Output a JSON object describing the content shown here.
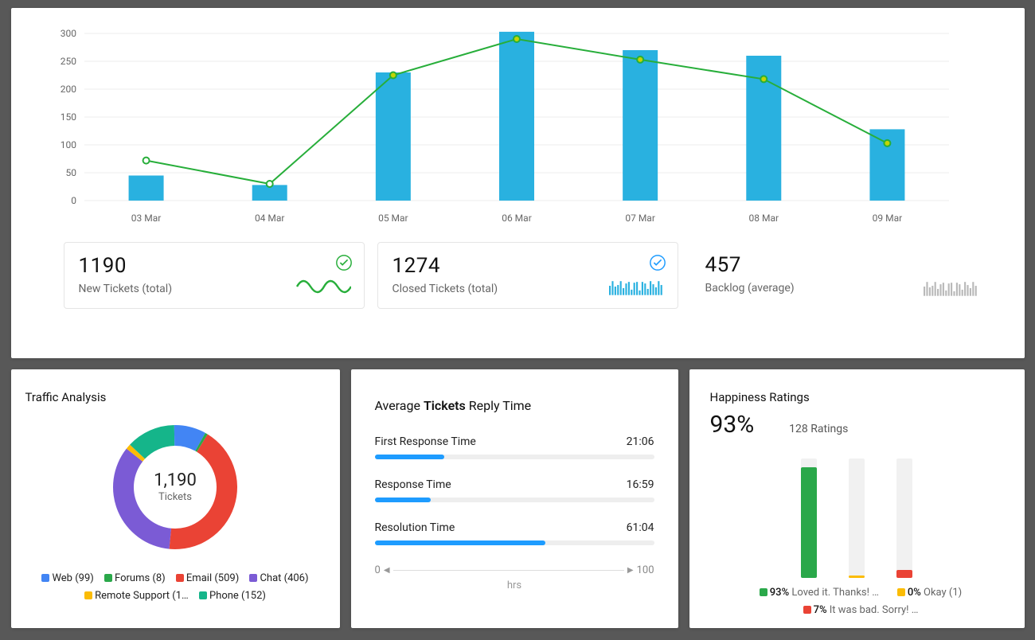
{
  "chart_data": {
    "type": "bar+line",
    "categories": [
      "03 Mar",
      "04 Mar",
      "05 Mar",
      "06 Mar",
      "07 Mar",
      "08 Mar",
      "09 Mar"
    ],
    "bars": [
      45,
      28,
      230,
      303,
      270,
      260,
      128
    ],
    "line": [
      72,
      30,
      225,
      290,
      253,
      218,
      103
    ],
    "ylim": [
      0,
      300
    ],
    "y_ticks": [
      0,
      50,
      100,
      150,
      200,
      250,
      300
    ]
  },
  "summary": {
    "new": {
      "value": "1190",
      "label": "New Tickets (total)"
    },
    "closed": {
      "value": "1274",
      "label": "Closed  Tickets (total)"
    },
    "backlog": {
      "value": "457",
      "label": "Backlog (average)"
    }
  },
  "colors": {
    "bar": "#29b1e0",
    "line": "#27ae3a",
    "gray_spark": "#b9b9b9"
  },
  "traffic": {
    "title": "Traffic Analysis",
    "total_value": "1,190",
    "total_label": "Tickets",
    "items": [
      {
        "label": "Web",
        "count": 99,
        "color": "#4285f4"
      },
      {
        "label": "Forums",
        "count": 8,
        "color": "#2aa84a"
      },
      {
        "label": "Email",
        "count": 509,
        "color": "#ea4335"
      },
      {
        "label": "Chat",
        "count": 406,
        "color": "#7b5bd5"
      },
      {
        "label": "Remote Support",
        "count": 16,
        "color": "#fbbc05",
        "display": "Remote Support (1…"
      },
      {
        "label": "Phone",
        "count": 152,
        "color": "#15b58a"
      }
    ]
  },
  "reply": {
    "title_pre": "Average",
    "title_bold": "Tickets",
    "title_post": "Reply Time",
    "metrics": [
      {
        "name": "First Response Time",
        "value": "21:06",
        "pct": 25
      },
      {
        "name": "Response Time",
        "value": "16:59",
        "pct": 20
      },
      {
        "name": "Resolution Time",
        "value": "61:04",
        "pct": 61
      }
    ],
    "axis_min": "0",
    "axis_max": "100",
    "axis_unit": "hrs"
  },
  "happiness": {
    "title": "Happiness Ratings",
    "big_pct": "93%",
    "ratings_label": "128 Ratings",
    "bars": [
      {
        "pct": 93,
        "color": "#2aa84a"
      },
      {
        "pct": 0,
        "color": "#fbbc05"
      },
      {
        "pct": 7,
        "color": "#ea4335"
      }
    ],
    "legend": [
      {
        "pct": "93%",
        "text": "Loved it. Thanks! …",
        "color": "#2aa84a"
      },
      {
        "pct": "0%",
        "text": "Okay (1)",
        "color": "#fbbc05"
      },
      {
        "pct": "7%",
        "text": "It was bad. Sorry! …",
        "color": "#ea4335"
      }
    ]
  }
}
